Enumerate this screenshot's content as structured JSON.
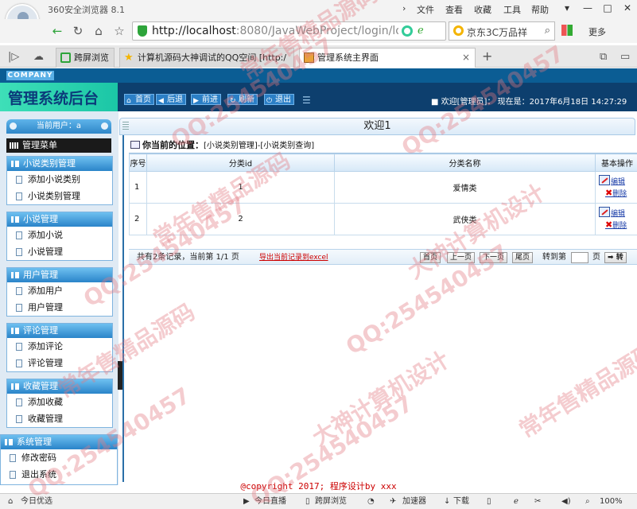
{
  "browser": {
    "title": "360安全浏览器 8.1",
    "menu": [
      "文件",
      "查看",
      "收藏",
      "工具",
      "帮助"
    ],
    "url_host": "http://localhost",
    "url_rest": ":8080/JavaWebProject/login/logi",
    "search_text": "京东3C万品祥",
    "more": "更多",
    "tabs": [
      {
        "label": "跨屏浏览"
      },
      {
        "label": "计算机源码大神调试的QQ空间 [http:/"
      },
      {
        "label": "管理系统主界面"
      }
    ],
    "status": {
      "left": "今日优选",
      "live": "今日直播",
      "cross": "跨屏浏览",
      "accel": "加速器",
      "download": "下载",
      "zoom": "100%"
    }
  },
  "app": {
    "company": "COMPANY",
    "title": "管理系统后台",
    "toolbar": [
      {
        "label": "首页",
        "icon": "home-icon"
      },
      {
        "label": "后退",
        "icon": "back-arrow-icon"
      },
      {
        "label": "前进",
        "icon": "forward-arrow-icon"
      },
      {
        "label": "刷新",
        "icon": "refresh-icon"
      },
      {
        "label": "退出",
        "icon": "power-icon"
      }
    ],
    "welcome_info": "欢迎[管理员]：  现在是：2017年6月18日 14:27:29",
    "sidebar": {
      "current_user": "当前用户：a",
      "menu_title": "管理菜单",
      "groups": [
        {
          "title": "小说类别管理",
          "items": [
            "添加小说类别",
            "小说类别管理"
          ]
        },
        {
          "title": "小说管理",
          "items": [
            "添加小说",
            "小说管理"
          ]
        },
        {
          "title": "用户管理",
          "items": [
            "添加用户",
            "用户管理"
          ]
        },
        {
          "title": "评论管理",
          "items": [
            "添加评论",
            "评论管理"
          ]
        },
        {
          "title": "收藏管理",
          "items": [
            "添加收藏",
            "收藏管理"
          ]
        },
        {
          "title": "系统管理",
          "items": [
            "修改密码",
            "退出系统"
          ]
        }
      ]
    },
    "main": {
      "heading": "欢迎1",
      "location_label": "你当前的位置：",
      "location_path": "[小说类别管理]-[小说类别查询]",
      "table": {
        "headers": [
          "序号",
          "分类id",
          "分类名称",
          "基本操作"
        ],
        "rows": [
          {
            "no": "1",
            "id": "1",
            "name": "爱情类"
          },
          {
            "no": "2",
            "id": "2",
            "name": "武侠类"
          }
        ],
        "edit_label": "编辑",
        "delete_label": "删除"
      },
      "pager": {
        "info": "共有2条记录，当前第 1/1 页",
        "export": "导出当前记录到excel",
        "first": "首页",
        "prev": "上一页",
        "next": "下一页",
        "last": "尾页",
        "goto": "转到第",
        "unit": "页",
        "go": "转"
      }
    },
    "footer": "@copyright 2017; 程序设计by xxx"
  },
  "watermarks": [
    "常年售精品源码",
    "QQ:254540457",
    "大神计算机设计"
  ]
}
